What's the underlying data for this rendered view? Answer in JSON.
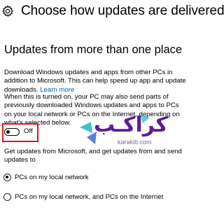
{
  "header": {
    "title": "Choose how updates are delivered",
    "icon": "gear-icon"
  },
  "section": {
    "heading": "Updates from more than one place",
    "description": "Download Windows updates and apps from other PCs in addition to Microsoft. This can help speed up app and update downloads.",
    "learn_more": "Learn more",
    "sharing_note": "When this is turned on, your PC may also send parts of previously downloaded Windows updates and apps to PCs on your local network or PCs on the Internet, depending on what's selected below."
  },
  "toggle": {
    "state_label": "Off",
    "on": false,
    "highlight_color": "#e81123"
  },
  "get_updates": {
    "label": "Get updates from Microsoft, and get updates from and send updates to",
    "options": [
      {
        "label": "PCs on my local network",
        "selected": true
      },
      {
        "label": "PCs on my local network, and PCs on the Internet",
        "selected": false
      }
    ]
  },
  "watermark": {
    "text": "كراكـب",
    "sub": "karakib.com",
    "colors": {
      "primary": "#4a0d8a",
      "teal": "#1fb5c1",
      "blue": "#2c5fd4"
    }
  },
  "colors": {
    "link": "#0063b1",
    "text": "#000000",
    "background": "#ffffff"
  }
}
